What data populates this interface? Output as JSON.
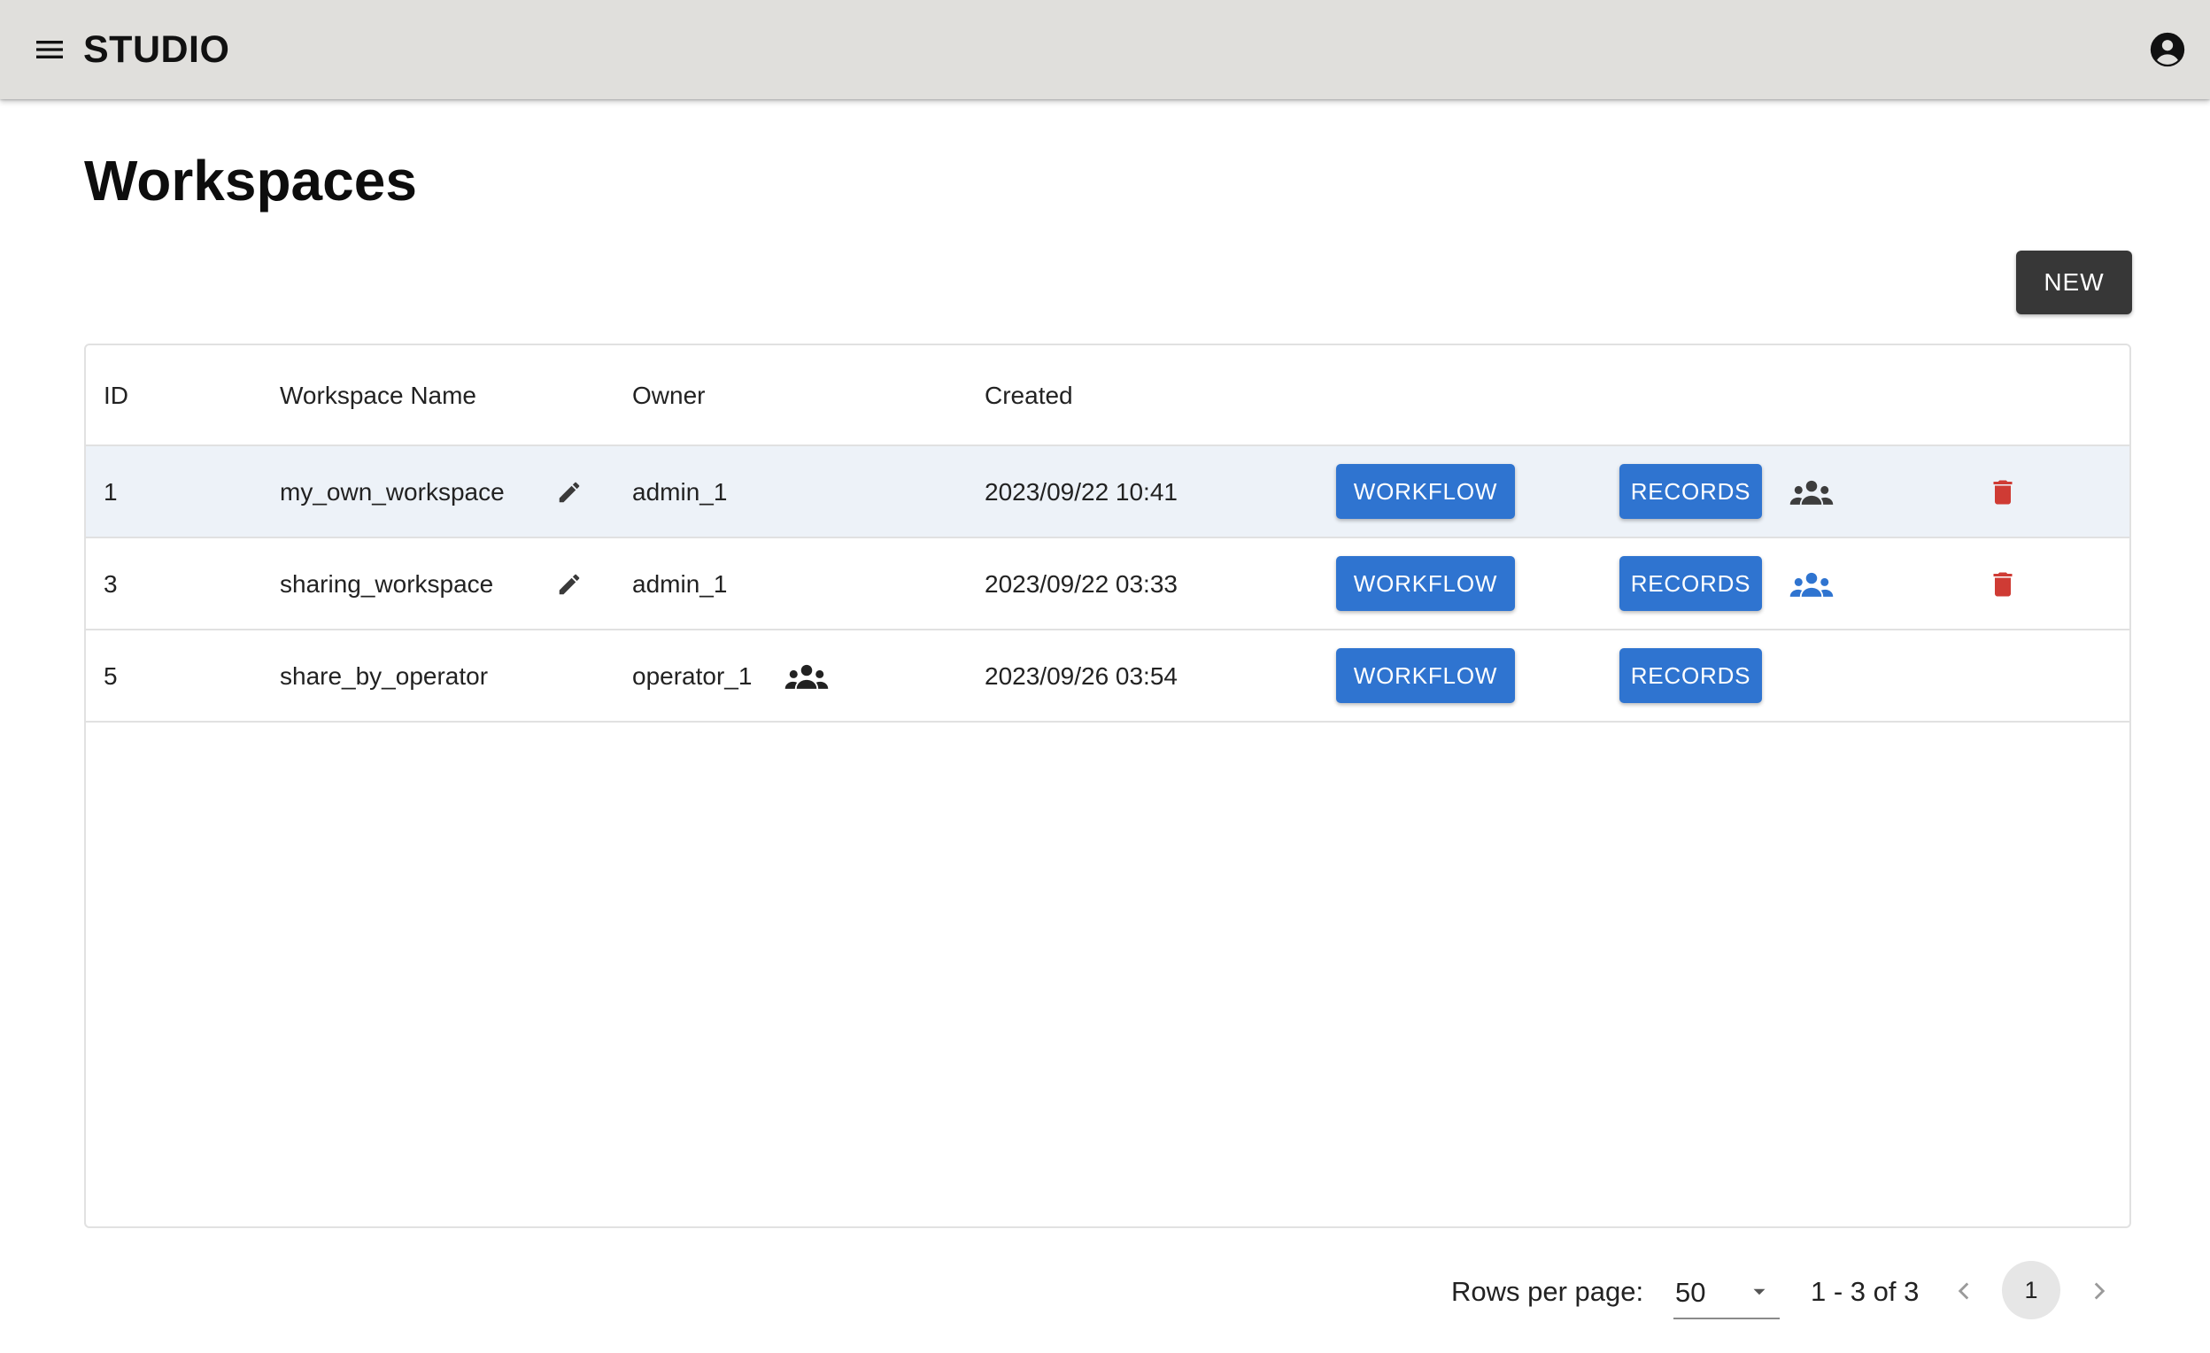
{
  "app": {
    "title": "STUDIO"
  },
  "page": {
    "title": "Workspaces",
    "new_label": "NEW"
  },
  "table": {
    "columns": [
      "ID",
      "Workspace Name",
      "Owner",
      "Created"
    ],
    "rows": [
      {
        "id": "1",
        "name": "my_own_workspace",
        "owner": "admin_1",
        "created": "2023/09/22 10:41",
        "workflow_label": "WORKFLOW",
        "records_label": "RECORDS",
        "share_icon_color": "#3d3d3d"
      },
      {
        "id": "3",
        "name": "sharing_workspace",
        "owner": "admin_1",
        "created": "2023/09/22 03:33",
        "workflow_label": "WORKFLOW",
        "records_label": "RECORDS",
        "share_icon_color": "#2f74d0"
      },
      {
        "id": "5",
        "name": "share_by_operator",
        "owner": "operator_1",
        "created": "2023/09/26 03:54",
        "workflow_label": "WORKFLOW",
        "records_label": "RECORDS"
      }
    ]
  },
  "pagination": {
    "rows_per_page_label": "Rows per page:",
    "rows_per_page": "50",
    "range": "1 - 3 of 3",
    "current_page": "1"
  },
  "colors": {
    "appbar": "#e0dfdc",
    "primary_button": "#2f74d0",
    "new_button": "#373737",
    "delete_icon": "#cf3b34",
    "selected_row": "#edf2f8"
  },
  "icons": {
    "menu": "menu-icon",
    "account": "account-circle-icon",
    "edit": "pencil-icon",
    "share": "group-icon",
    "delete": "trash-icon",
    "prev": "chevron-left-icon",
    "next": "chevron-right-icon",
    "dropdown": "caret-down-icon"
  }
}
